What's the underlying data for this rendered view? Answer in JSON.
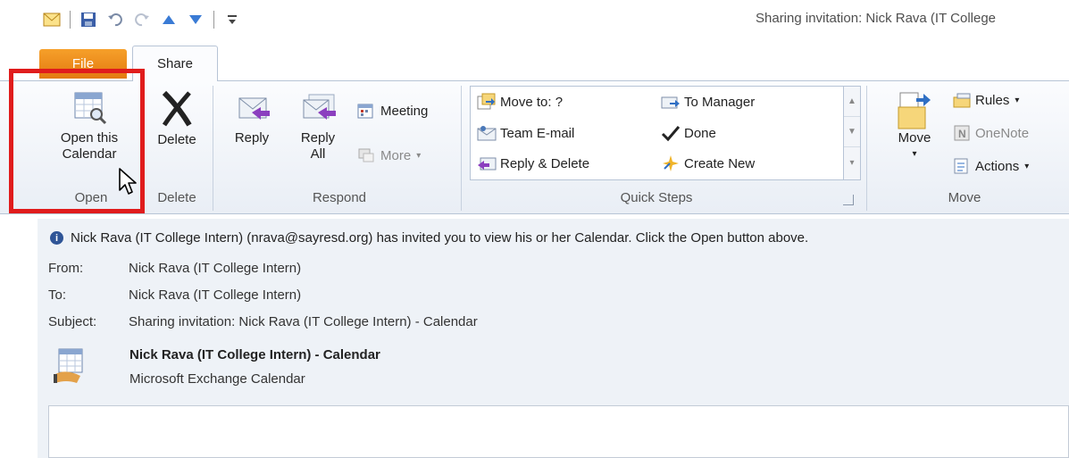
{
  "window": {
    "title": "Sharing invitation: Nick Rava (IT College"
  },
  "quick_access": {
    "icons": [
      "envelope-icon",
      "save-icon",
      "undo-icon",
      "redo-icon",
      "up-arrow-icon",
      "down-arrow-icon",
      "customize-qat-icon"
    ]
  },
  "tabs": {
    "file": "File",
    "share": "Share"
  },
  "ribbon": {
    "groups": {
      "open": "Open",
      "delete": "Delete",
      "respond": "Respond",
      "quick_steps": "Quick Steps",
      "move": "Move"
    },
    "open_this_line1": "Open this",
    "open_this_line2": "Calendar",
    "delete": "Delete",
    "reply": "Reply",
    "reply_all_line1": "Reply",
    "reply_all_line2": "All",
    "meeting": "Meeting",
    "more": "More",
    "quick_steps": {
      "move_to": "Move to: ?",
      "team_email": "Team E-mail",
      "reply_delete": "Reply & Delete",
      "to_manager": "To Manager",
      "done": "Done",
      "create_new": "Create New"
    },
    "move": "Move",
    "rules": "Rules",
    "onenote": "OneNote",
    "actions": "Actions"
  },
  "message": {
    "info": "Nick Rava (IT College Intern) (nrava@sayresd.org) has invited you to view his or her Calendar.  Click the Open button above.",
    "from_label": "From:",
    "from_value": "Nick Rava (IT College Intern)",
    "to_label": "To:",
    "to_value": "Nick Rava (IT College Intern)",
    "subject_label": "Subject:",
    "subject_value": "Sharing invitation: Nick Rava (IT College Intern) - Calendar",
    "attachment_title": "Nick Rava (IT College Intern) - Calendar",
    "attachment_subtitle": "Microsoft Exchange Calendar"
  },
  "colors": {
    "highlight": "#e01c1c",
    "file_tab": "#e37a10",
    "info_icon": "#2f5597"
  }
}
